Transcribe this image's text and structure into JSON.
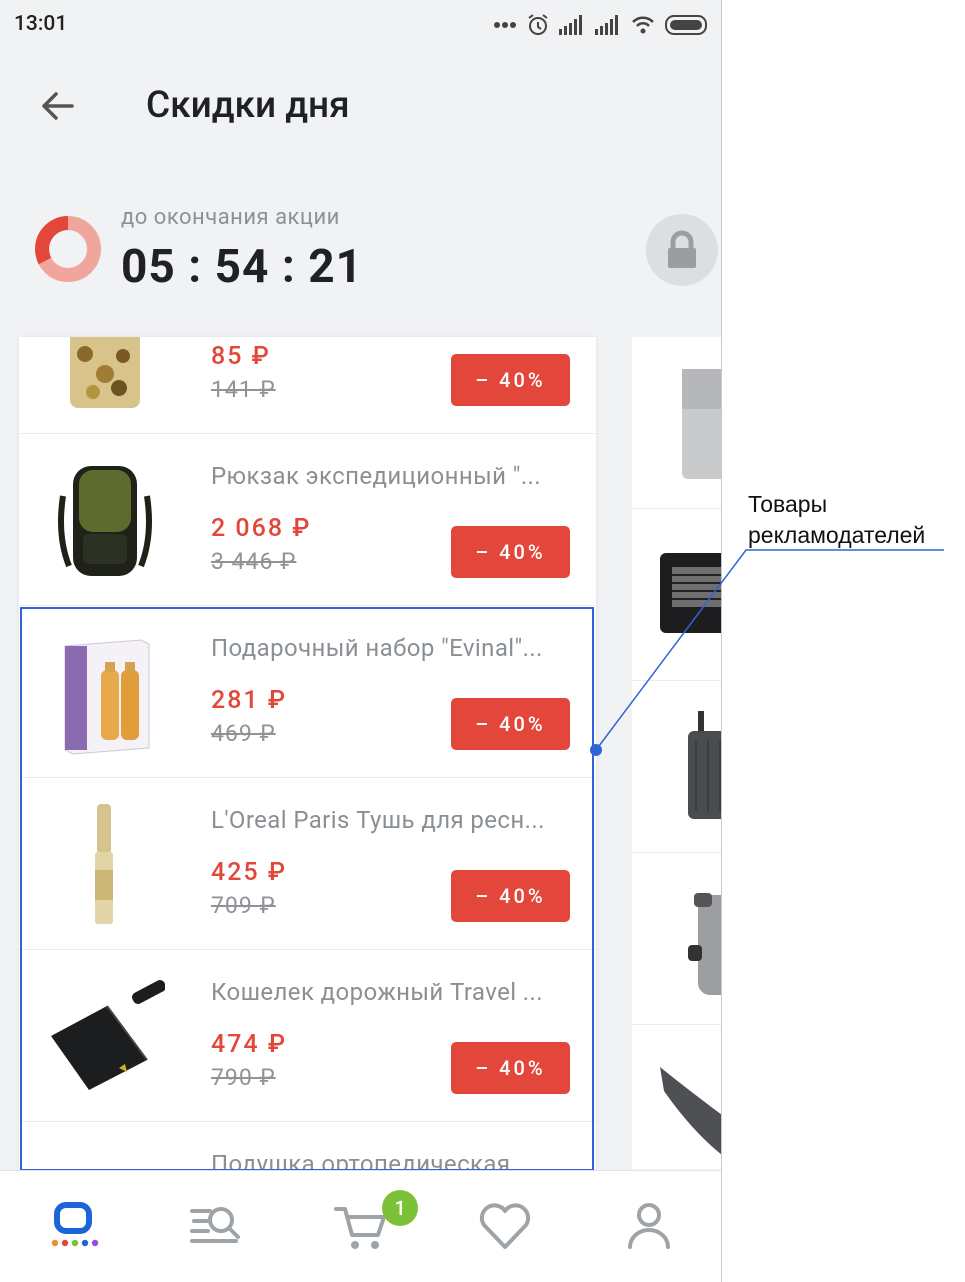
{
  "status_bar": {
    "time": "13:01"
  },
  "header": {
    "title": "Скидки дня"
  },
  "timer": {
    "caption": "до окончания акции",
    "value": "05 : 54 : 21"
  },
  "products": [
    {
      "name": "",
      "price": "85 ₽",
      "old_price": "141 ₽",
      "discount": "– 40%",
      "image": "souvenir-pack"
    },
    {
      "name": "Рюкзак экспедиционный \"...",
      "price": "2 068 ₽",
      "old_price": "3 446 ₽",
      "discount": "– 40%",
      "image": "backpack"
    },
    {
      "name": "Подарочный набор \"Evinal\"...",
      "price": "281 ₽",
      "old_price": "469 ₽",
      "discount": "– 40%",
      "image": "gift-set"
    },
    {
      "name": "L'Oreal Paris Тушь для ресн...",
      "price": "425 ₽",
      "old_price": "709 ₽",
      "discount": "– 40%",
      "image": "mascara"
    },
    {
      "name": "Кошелек дорожный Travel ...",
      "price": "474 ₽",
      "old_price": "790 ₽",
      "discount": "– 40%",
      "image": "wallet"
    },
    {
      "name": "Подушка ортопедическая",
      "price": "",
      "old_price": "",
      "discount": "",
      "image": ""
    }
  ],
  "side_items": [
    "lighter",
    "gas-heater",
    "suitcase",
    "dry-bag",
    "sleeping-bag"
  ],
  "bottom_nav": {
    "items": [
      "home-icon",
      "catalog-search-icon",
      "cart-icon",
      "heart-icon",
      "profile-icon"
    ],
    "cart_count": "1"
  },
  "annotation": {
    "line1": "Товары",
    "line2": "рекламодателей"
  },
  "colors": {
    "accent": "#e3463a",
    "highlight": "#2f64d8",
    "badge": "#7cc237"
  }
}
